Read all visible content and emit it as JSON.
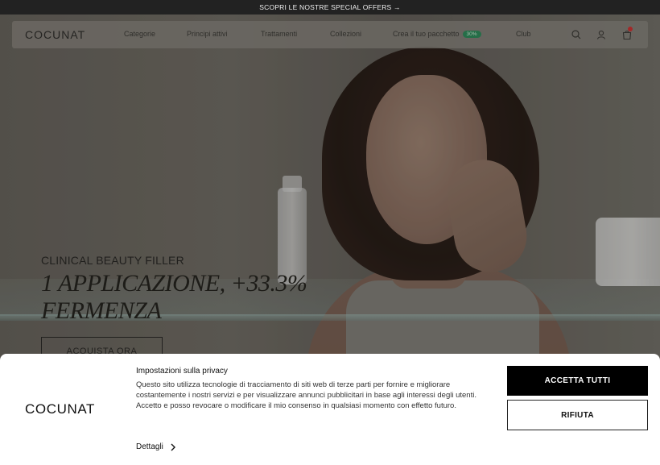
{
  "announcement": {
    "text": "SCOPRI LE NOSTRE SPECIAL OFFERS →"
  },
  "header": {
    "logo": "COCUNAT",
    "nav": [
      {
        "label": "Categorie"
      },
      {
        "label": "Principi attivi"
      },
      {
        "label": "Trattamenti"
      },
      {
        "label": "Collezioni"
      },
      {
        "label": "Crea il tuo pacchetto",
        "badge": "30%"
      },
      {
        "label": "Club"
      }
    ],
    "icons": [
      "search-icon",
      "user-icon",
      "cart-icon"
    ],
    "cart_count": ""
  },
  "hero": {
    "eyebrow": "CLINICAL BEAUTY FILLER",
    "headline_line1": "1 APPLICAZIONE, +33.3%",
    "headline_line2": "FERMENZA",
    "cta": "ACQUISTA ORA"
  },
  "cookie_banner": {
    "logo": "COCUNAT",
    "title": "Impostazioni sulla privacy",
    "text": "Questo sito utilizza tecnologie di tracciamento di siti web di terze parti per fornire e migliorare costantemente i nostri servizi e per visualizzare annunci pubblicitari in base agli interessi degli utenti. Accetto e posso revocare o modificare il mio consenso in qualsiasi momento con effetto futuro.",
    "details": "Dettagli",
    "accept": "ACCETTA TUTTI",
    "refuse": "RIFIUTA"
  },
  "colors": {
    "accent_badge": "#2f8a5a",
    "accept_bg": "#000000",
    "banner_bg": "#ffffff"
  }
}
